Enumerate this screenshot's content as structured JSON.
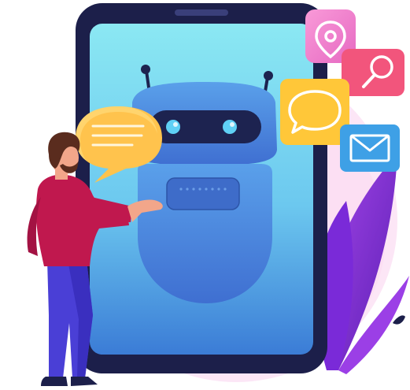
{
  "illustration": {
    "subject": "chatbot-on-smartphone",
    "icons": [
      "location-pin-icon",
      "search-icon",
      "chat-bubble-icon",
      "mail-icon"
    ],
    "colors": {
      "phone_frame": "#1c1f4a",
      "screen_top": "#86e6f2",
      "screen_bottom": "#3a7bd5",
      "robot_body": "#4a8fe0",
      "robot_visor": "#1d2350",
      "robot_eye": "#5fd0f5",
      "chat_bubble": "#ffc34d",
      "pin_bg": "#f47fcf",
      "search_bg": "#f2557c",
      "message_bg": "#ffd23f",
      "mail_bg": "#3ea0e6",
      "leaves": "#8a2be2",
      "bg_circle": "#fbe3f5",
      "shirt": "#c0184e",
      "pants": "#4a3fd6",
      "hair": "#5a2c1e",
      "skin": "#f2a68a"
    }
  }
}
